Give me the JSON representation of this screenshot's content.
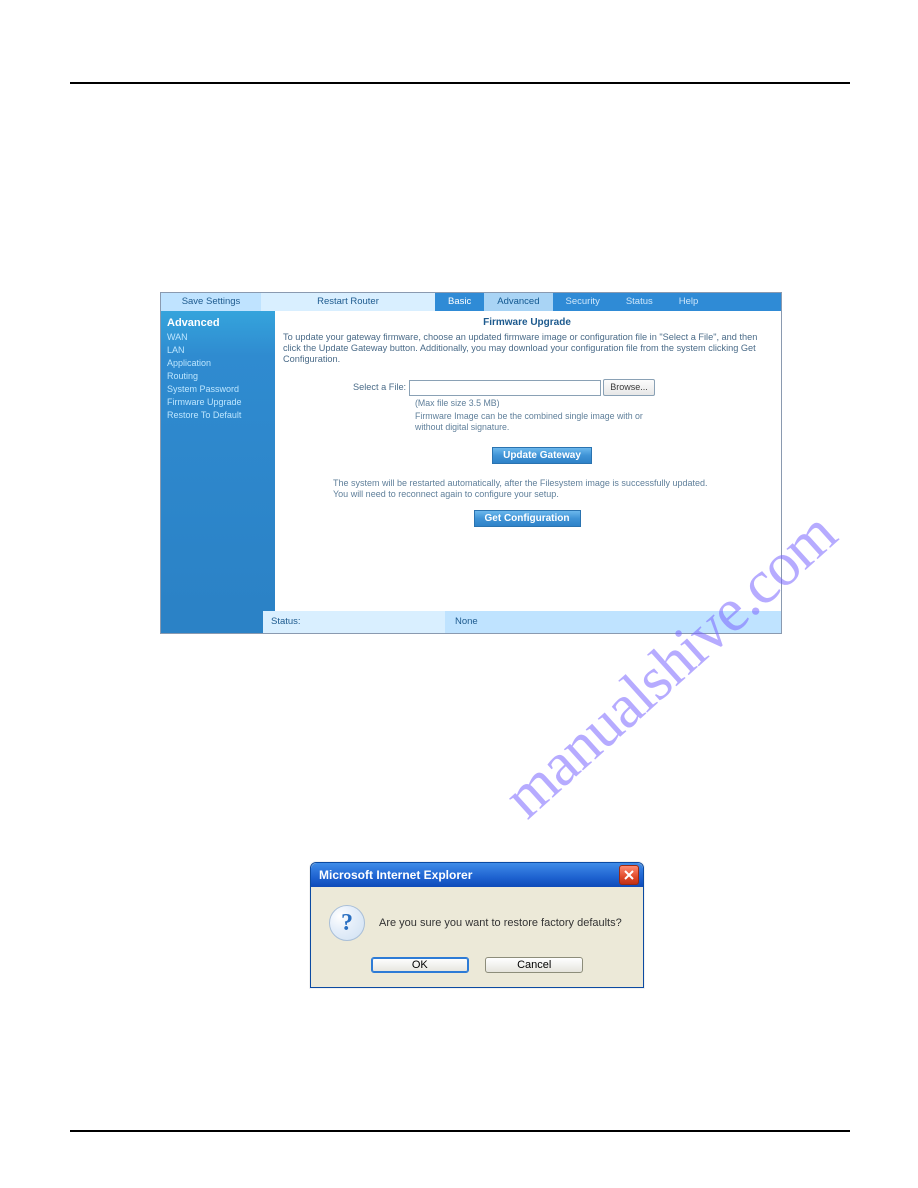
{
  "watermark": "manualshive.com",
  "router": {
    "topbar": {
      "save": "Save Settings",
      "restart": "Restart Router"
    },
    "tabs": [
      "Basic",
      "Advanced",
      "Security",
      "Status",
      "Help"
    ],
    "sidebar": {
      "heading": "Advanced",
      "items": [
        "WAN",
        "LAN",
        "Application",
        "Routing",
        "System Password",
        "Firmware Upgrade",
        "Restore To Default"
      ]
    },
    "content": {
      "title": "Firmware Upgrade",
      "intro": "To update your gateway firmware, choose an updated firmware image or configuration file in \"Select a File\", and then click the Update Gateway button. Additionally, you may download your configuration file from the system clicking Get Configuration.",
      "select_label": "Select a File:",
      "browse": "Browse...",
      "max_note": "(Max file size 3.5 MB)",
      "fw_note": "Firmware Image can be the combined single image with or without digital signature.",
      "update_btn": "Update Gateway",
      "restart_note": "The system will be restarted automatically, after the Filesystem image is successfully updated. You will need to reconnect again to configure your setup.",
      "getconf_btn": "Get Configuration"
    },
    "status": {
      "label": "Status:",
      "value": "None"
    }
  },
  "dialog": {
    "title": "Microsoft Internet Explorer",
    "message": "Are you sure you want to restore factory defaults?",
    "ok": "OK",
    "cancel": "Cancel"
  }
}
